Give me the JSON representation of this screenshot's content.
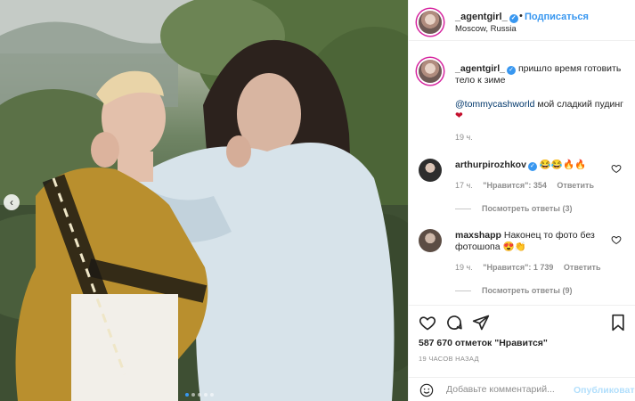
{
  "header": {
    "username": "_agentgirl_",
    "verified": "✓",
    "separator": "•",
    "follow_label": "Подписаться",
    "location": "Moscow, Russia"
  },
  "caption": {
    "username": "_agentgirl_",
    "verified": "✓",
    "text_1": " пришло время готовить тело к зиме",
    "mention": "@tommycashworld",
    "text_2": " мой сладкий пудинг",
    "emoji": "❤",
    "time": "19 ч."
  },
  "comments": [
    {
      "username": "arthurpirozhkov",
      "verified": "✓",
      "text": "😂😂🔥🔥",
      "time": "17 ч.",
      "likes": "\"Нравится\": 354",
      "reply_label": "Ответить",
      "view_replies": "Посмотреть ответы (3)"
    },
    {
      "username": "maxshapp",
      "text": "Наконец то фото без фотошопа 😍👏",
      "time": "19 ч.",
      "likes": "\"Нравится\": 1 739",
      "reply_label": "Ответить",
      "view_replies": "Посмотреть ответы (9)"
    }
  ],
  "actions": {
    "likes_count": "587 670 отметок \"Нравится\"",
    "time_ago": "19 ЧАСОВ НАЗАД"
  },
  "add_comment": {
    "placeholder": "Добавьте комментарий...",
    "post_label": "Опубликовать"
  },
  "carousel": {
    "prev_arrow": "‹",
    "slide_count": 5,
    "active_index": 0
  },
  "colors": {
    "accent": "#3897f0",
    "text": "#262626",
    "muted": "#8e8e8e",
    "post_disabled": "#b2dffc"
  },
  "icons": [
    "heart-icon",
    "comment-icon",
    "share-icon",
    "bookmark-icon",
    "emoji-icon",
    "verified-icon",
    "chevron-left-icon"
  ]
}
